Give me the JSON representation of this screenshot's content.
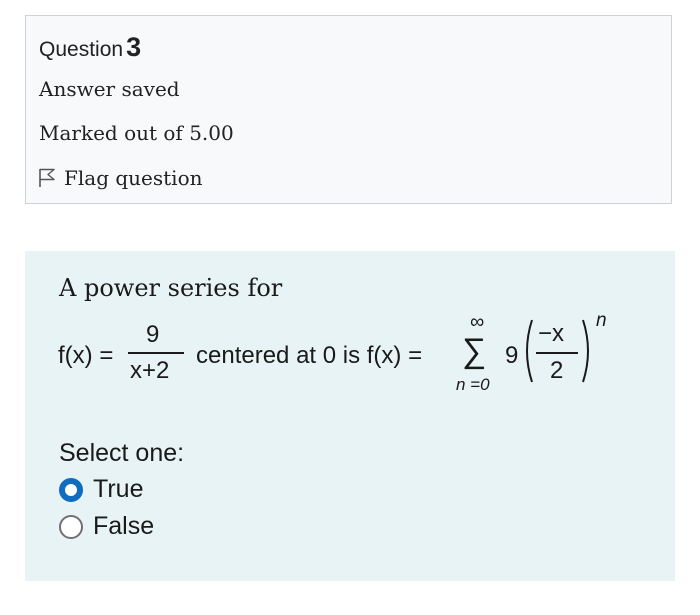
{
  "question": {
    "label": "Question",
    "number": "3",
    "status": "Answer saved",
    "marked": "Marked out of 5.00",
    "flag_label": "Flag question"
  },
  "content": {
    "intro": "A power series for",
    "math": {
      "fx": "f(x) =",
      "numerator": "9",
      "denominator": "x+2",
      "middle": "centered at 0 is f(x) =",
      "inf": "∞",
      "sigma": "∑",
      "lower": "n =0",
      "coef": "9",
      "inner_num": "−x",
      "inner_den": "2",
      "exponent": "n"
    },
    "select_label": "Select one:",
    "options": [
      {
        "label": "True",
        "selected": true
      },
      {
        "label": "False",
        "selected": false
      }
    ]
  },
  "colors": {
    "accent": "#0f6cbf",
    "info_bg": "#f8f9fa",
    "content_bg": "#e8f3f6"
  }
}
